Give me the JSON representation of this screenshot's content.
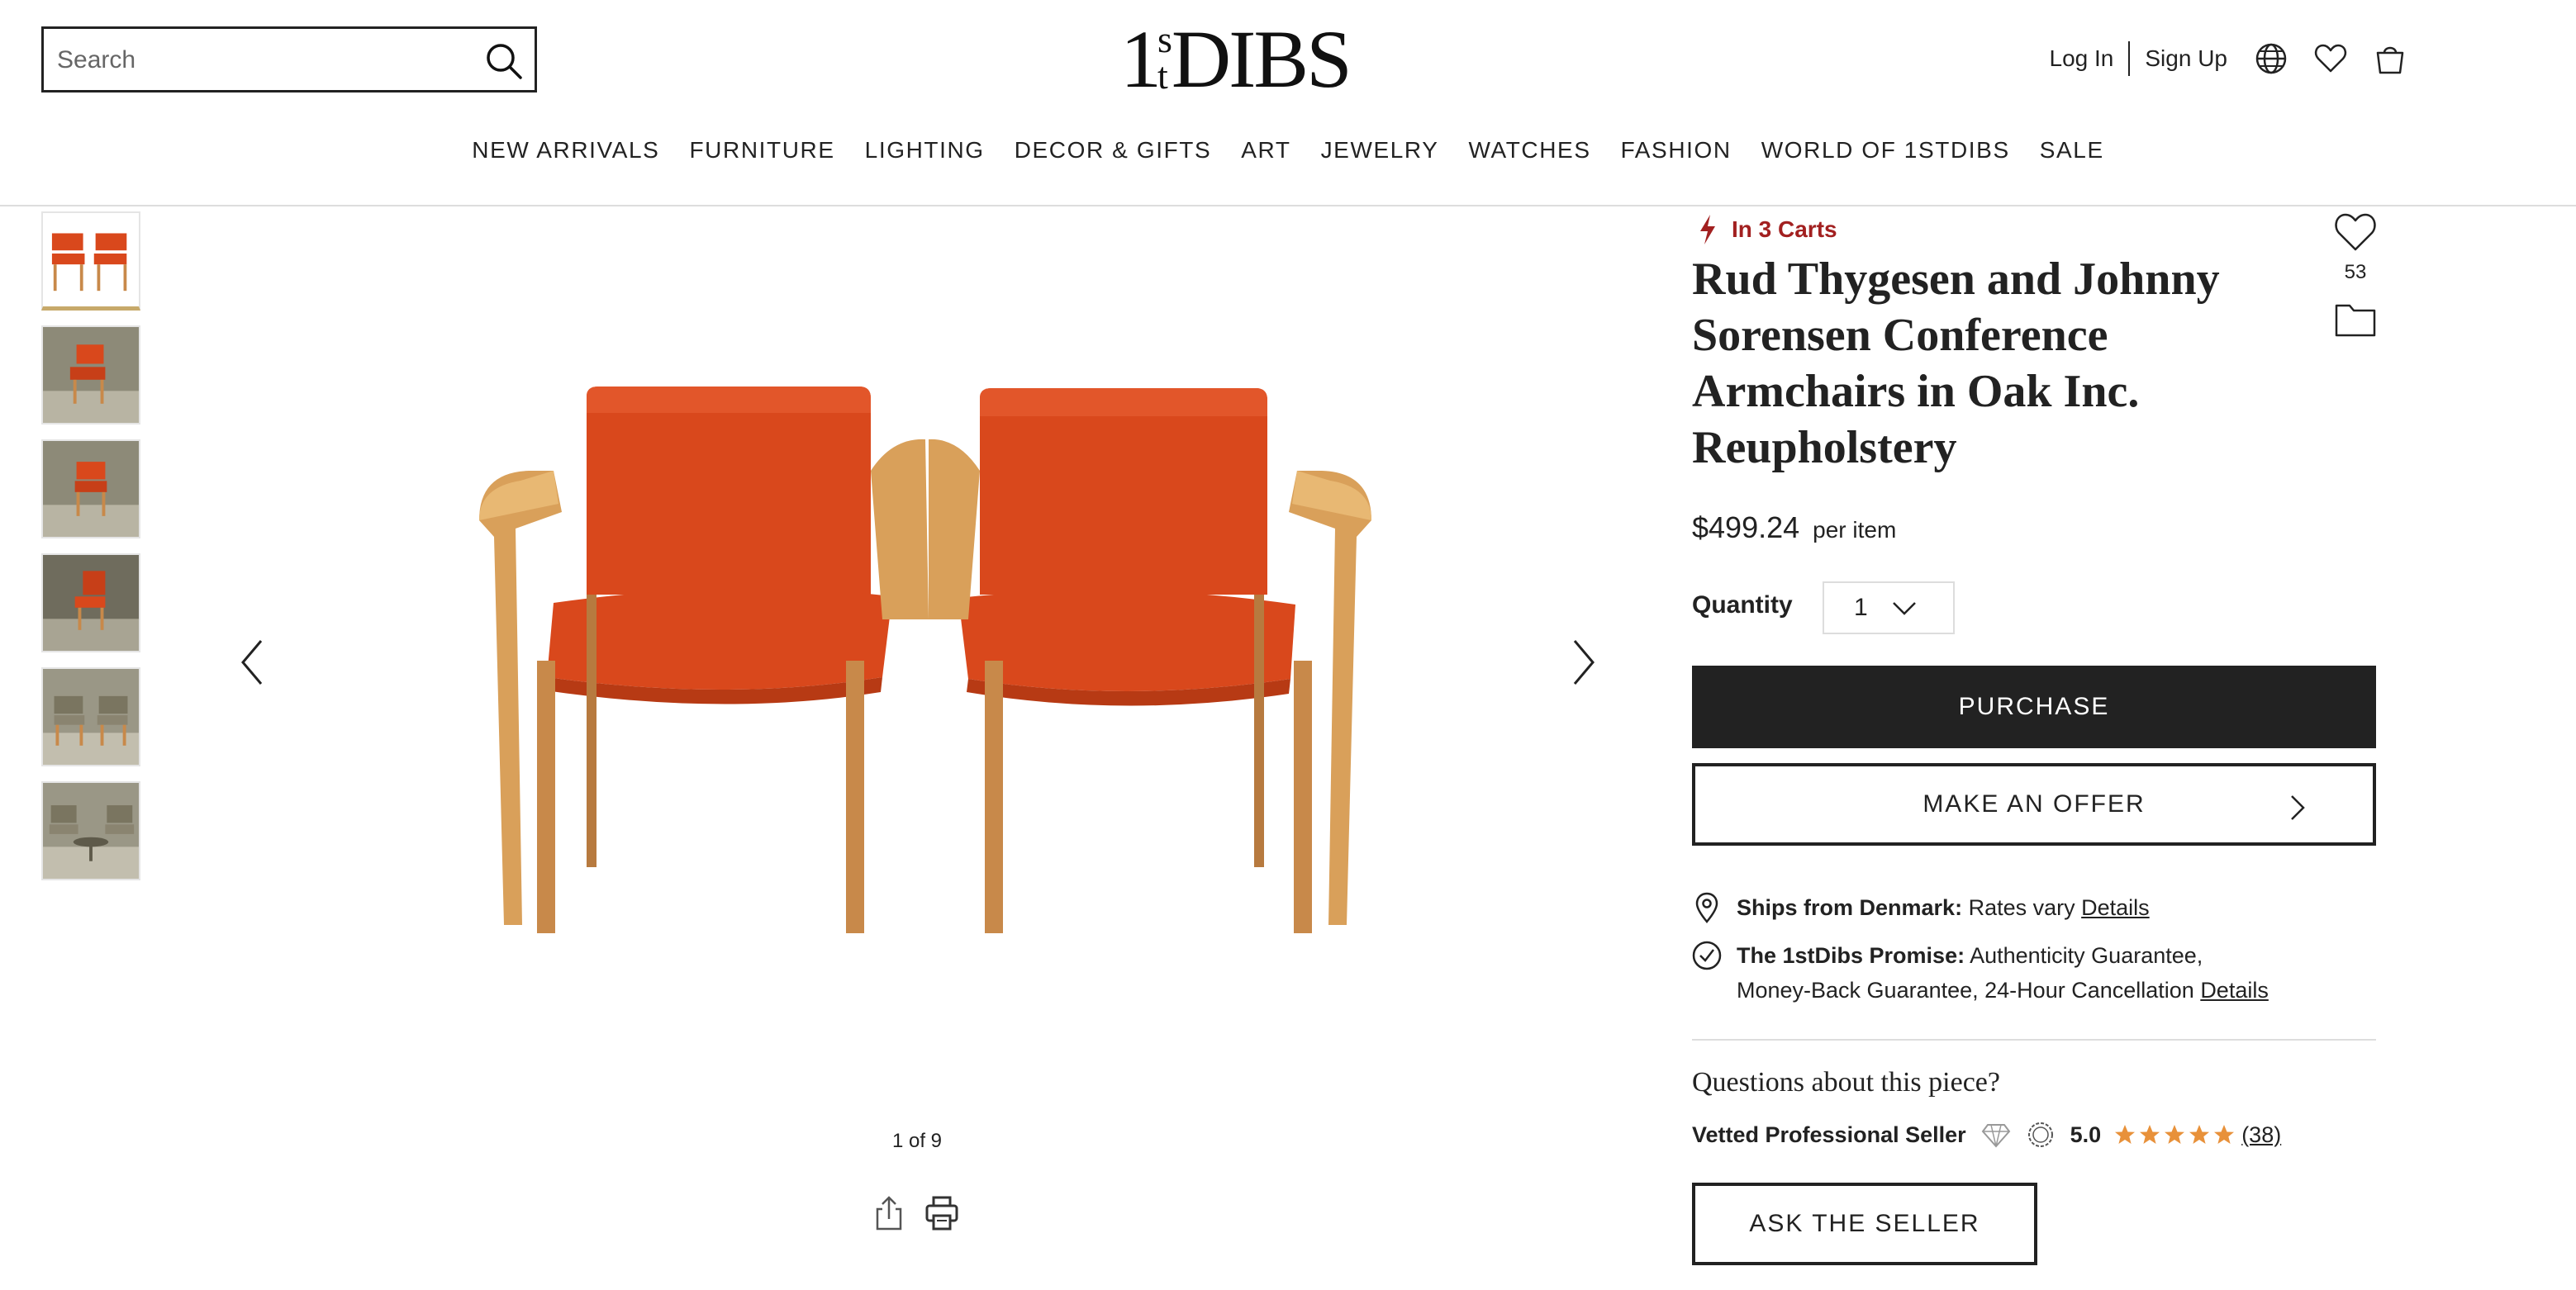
{
  "header": {
    "search_placeholder": "Search",
    "logo": {
      "one": "1",
      "s": "s",
      "t": "t",
      "dibs": "DIBS"
    },
    "login": "Log In",
    "signup": "Sign Up"
  },
  "nav": [
    "NEW ARRIVALS",
    "FURNITURE",
    "LIGHTING",
    "DECOR & GIFTS",
    "ART",
    "JEWELRY",
    "WATCHES",
    "FASHION",
    "WORLD OF 1STDIBS",
    "SALE"
  ],
  "gallery": {
    "counter": "1 of 9",
    "thumbnail_count": 6
  },
  "product": {
    "in_carts": "In 3 Carts",
    "title": "Rud Thygesen and Johnny Sorensen Conference Armchairs in Oak Inc. Reupholstery",
    "favorite_count": "53",
    "price": "$499.24",
    "price_unit": "per item",
    "quantity_label": "Quantity",
    "quantity_value": "1",
    "purchase_label": "PURCHASE",
    "offer_label": "MAKE AN OFFER",
    "ships_bold": "Ships from Denmark:",
    "ships_text": "Rates vary",
    "ships_link": "Details",
    "promise_bold": "The 1stDibs Promise:",
    "promise_text_1": "Authenticity Guarantee,",
    "promise_text_2": "Money-Back Guarantee, 24-Hour Cancellation",
    "promise_link": "Details",
    "questions": "Questions about this piece?",
    "vetted": "Vetted Professional Seller",
    "rating": "5.0",
    "stars": 5,
    "reviews": "(38)",
    "ask_label": "ASK THE SELLER"
  },
  "colors": {
    "accent_red": "#a22020",
    "upholstery": "#d9481c",
    "oak": "#d9a05a",
    "star": "#e8913a"
  }
}
